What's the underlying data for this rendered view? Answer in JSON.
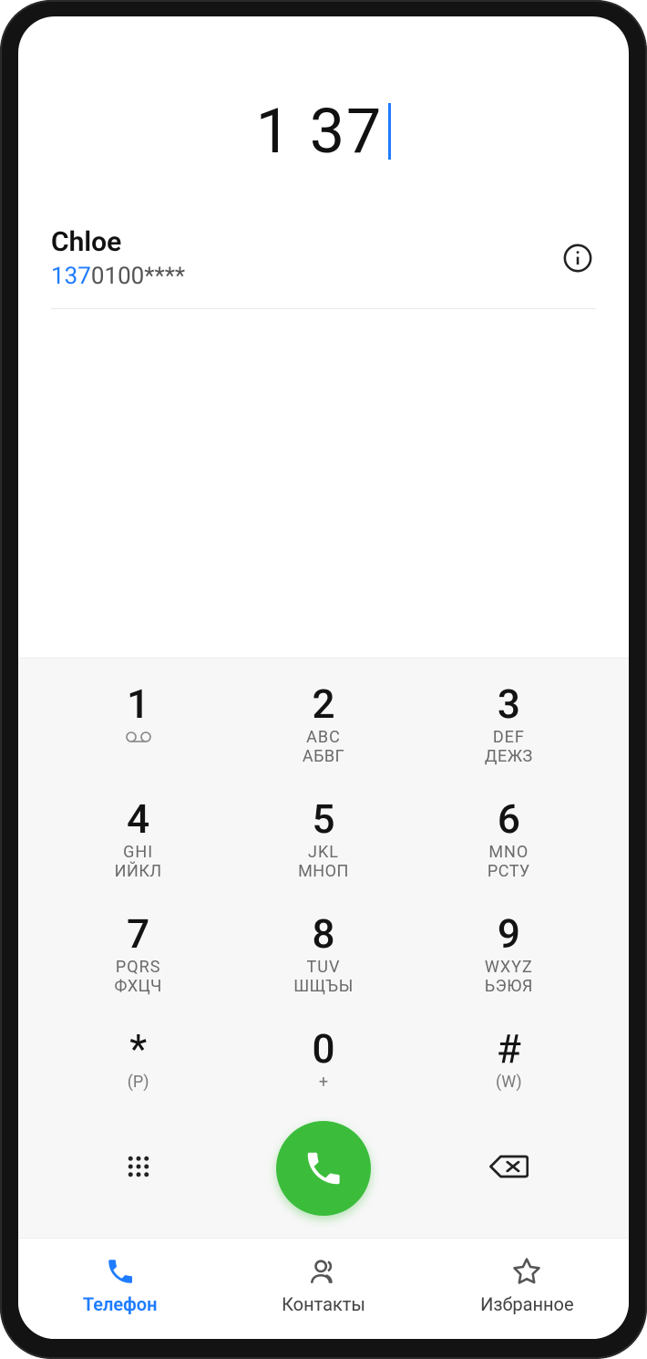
{
  "dialed_number": "1 37",
  "suggestion": {
    "name": "Chloe",
    "number_match": "137",
    "number_rest": "0100****"
  },
  "keypad": [
    {
      "digit": "1",
      "sub1": "",
      "sub2": "",
      "vm": true
    },
    {
      "digit": "2",
      "sub1": "ABC",
      "sub2": "АБВГ",
      "vm": false
    },
    {
      "digit": "3",
      "sub1": "DEF",
      "sub2": "ДЕЖЗ",
      "vm": false
    },
    {
      "digit": "4",
      "sub1": "GHI",
      "sub2": "ИЙКЛ",
      "vm": false
    },
    {
      "digit": "5",
      "sub1": "JKL",
      "sub2": "МНОП",
      "vm": false
    },
    {
      "digit": "6",
      "sub1": "MNO",
      "sub2": "РСТУ",
      "vm": false
    },
    {
      "digit": "7",
      "sub1": "PQRS",
      "sub2": "ФХЦЧ",
      "vm": false
    },
    {
      "digit": "8",
      "sub1": "TUV",
      "sub2": "ШЩЪЫ",
      "vm": false
    },
    {
      "digit": "9",
      "sub1": "WXYZ",
      "sub2": "ЬЭЮЯ",
      "vm": false
    },
    {
      "digit": "*",
      "sub1": "(P)",
      "sub2": "",
      "vm": false
    },
    {
      "digit": "0",
      "sub1": "+",
      "sub2": "",
      "vm": false
    },
    {
      "digit": "#",
      "sub1": "(W)",
      "sub2": "",
      "vm": false
    }
  ],
  "nav": {
    "phone": "Телефон",
    "contacts": "Контакты",
    "favorites": "Избранное"
  },
  "colors": {
    "accent": "#1f7cff",
    "call_green": "#3bbd3b"
  }
}
